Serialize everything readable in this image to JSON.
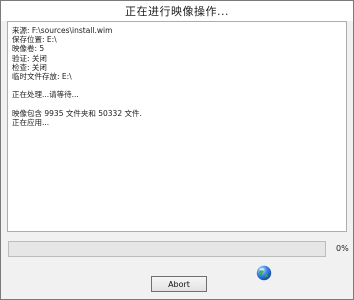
{
  "window": {
    "title": "正在进行映像操作..."
  },
  "log": {
    "lines": [
      "来源: F:\\sources\\install.wim",
      "保存位置: E:\\",
      "映像卷: 5",
      "验证: 关闭",
      "检查: 关闭",
      "临时文件存放: E:\\",
      "",
      "正在处理...请等待...",
      "",
      "映像包含 9935 文件夹和 50332 文件.",
      "正在应用..."
    ]
  },
  "progress": {
    "value": 0,
    "label": "0%"
  },
  "buttons": {
    "abort_label": "Abort"
  },
  "icons": {
    "status": "globe-icon"
  },
  "colors": {
    "progress_fill": "#06b025",
    "globe": "#2a6fd6"
  }
}
